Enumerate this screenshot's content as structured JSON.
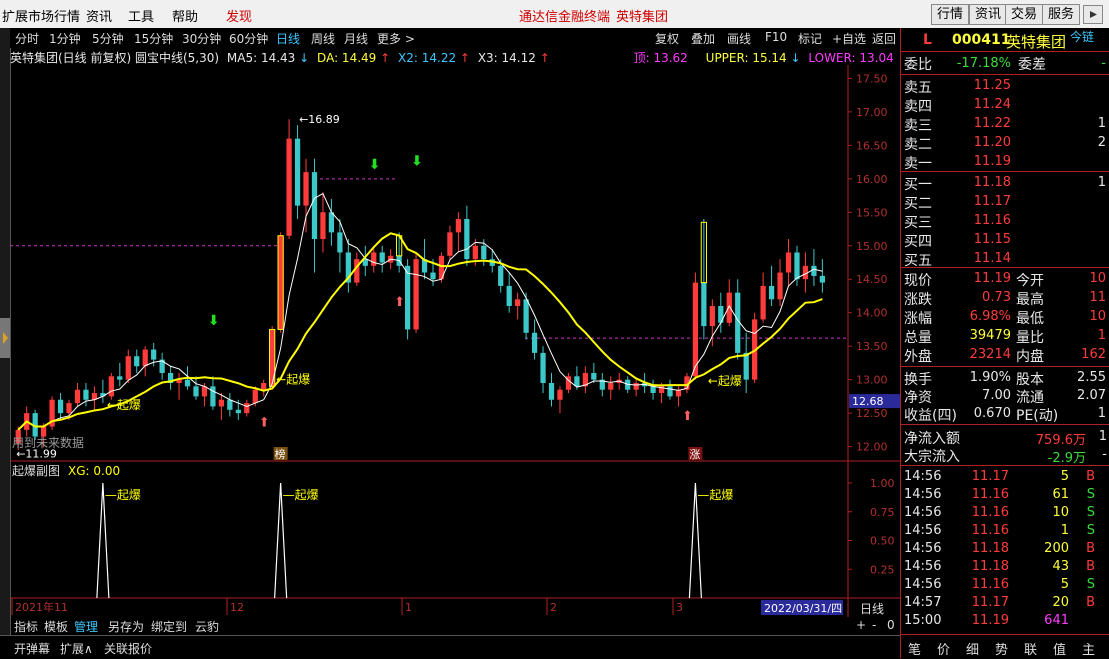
{
  "menu": {
    "items": [
      "扩展市场行情",
      "资讯",
      "工具",
      "帮助"
    ],
    "discover": "发现",
    "center_title": "通达信金融终端",
    "center_stock": "英特集团",
    "right_buttons": [
      "行情",
      "资讯",
      "交易",
      "服务"
    ]
  },
  "periods": {
    "items": [
      "分时",
      "1分钟",
      "5分钟",
      "15分钟",
      "30分钟",
      "60分钟",
      "日线",
      "周线",
      "月线",
      "更多 >"
    ],
    "active_index": 6,
    "right_tools": [
      "复权",
      "叠加",
      "画线",
      "F10",
      "标记",
      "+自选",
      "返回"
    ]
  },
  "title_bar": {
    "name": "英特集团(日线 前复权) 圆宝中线(5,30)",
    "ma5": "MA5: 14.43",
    "da": "DA: 14.49",
    "x2": "X2: 14.22",
    "x3": "X3: 14.12",
    "ding": "顶: 13.62",
    "upper": "UPPER: 15.14",
    "lower": "LOWER: 13.04"
  },
  "colors": {
    "up": "#ff3c3c",
    "down": "#3cc8c8",
    "ma": "#ffffff",
    "mid": "#ffff00",
    "dash": "#cc33cc",
    "accent": "#3cc8ff"
  },
  "chart_data": {
    "type": "candlestick",
    "ylim": [
      11.8,
      17.7
    ],
    "yticks": [
      "17.50",
      "17.00",
      "16.50",
      "16.00",
      "15.50",
      "15.00",
      "14.50",
      "14.00",
      "13.50",
      "13.00",
      "12.50",
      "12.00"
    ],
    "price_tag": "12.68",
    "max_label": "16.89",
    "min_label": "11.99",
    "qibao_labels": [
      "起爆",
      "起爆",
      "起爆"
    ],
    "future_note": "用到未来数据",
    "badge_bang": "榜",
    "badge_zhang": "涨",
    "candles": [
      [
        12.05,
        12.3,
        11.95,
        12.25
      ],
      [
        12.25,
        12.6,
        12.15,
        12.5
      ],
      [
        12.5,
        12.55,
        12.1,
        12.15
      ],
      [
        12.15,
        12.35,
        11.99,
        12.3
      ],
      [
        12.3,
        12.75,
        12.25,
        12.7
      ],
      [
        12.7,
        12.8,
        12.4,
        12.5
      ],
      [
        12.5,
        12.7,
        12.4,
        12.65
      ],
      [
        12.65,
        12.95,
        12.6,
        12.85
      ],
      [
        12.85,
        12.95,
        12.6,
        12.7
      ],
      [
        12.7,
        12.9,
        12.55,
        12.8
      ],
      [
        12.8,
        13.0,
        12.65,
        12.75
      ],
      [
        12.75,
        13.1,
        12.7,
        13.05
      ],
      [
        13.05,
        13.25,
        12.9,
        13.0
      ],
      [
        13.0,
        13.45,
        12.95,
        13.35
      ],
      [
        13.35,
        13.45,
        13.1,
        13.2
      ],
      [
        13.2,
        13.5,
        13.05,
        13.45
      ],
      [
        13.45,
        13.55,
        13.2,
        13.3
      ],
      [
        13.3,
        13.4,
        13.0,
        13.1
      ],
      [
        13.1,
        13.2,
        12.85,
        12.95
      ],
      [
        12.95,
        13.1,
        12.7,
        13.0
      ],
      [
        13.0,
        13.2,
        12.85,
        12.9
      ],
      [
        12.9,
        13.05,
        12.7,
        12.75
      ],
      [
        12.75,
        12.95,
        12.6,
        12.9
      ],
      [
        12.9,
        13.05,
        12.55,
        12.6
      ],
      [
        12.6,
        12.8,
        12.4,
        12.7
      ],
      [
        12.7,
        12.8,
        12.45,
        12.55
      ],
      [
        12.55,
        12.7,
        12.4,
        12.5
      ],
      [
        12.5,
        12.7,
        12.45,
        12.65
      ],
      [
        12.65,
        12.9,
        12.6,
        12.85
      ],
      [
        12.85,
        13.0,
        12.75,
        12.95
      ],
      [
        12.9,
        13.8,
        12.85,
        13.75
      ],
      [
        13.75,
        15.2,
        13.7,
        15.15
      ],
      [
        15.15,
        16.89,
        15.1,
        16.6
      ],
      [
        16.6,
        16.8,
        15.4,
        15.6
      ],
      [
        15.6,
        16.3,
        15.2,
        16.1
      ],
      [
        16.1,
        16.3,
        14.6,
        15.1
      ],
      [
        15.1,
        15.8,
        14.9,
        15.5
      ],
      [
        15.5,
        15.7,
        15.0,
        15.2
      ],
      [
        15.2,
        15.4,
        14.6,
        14.9
      ],
      [
        14.9,
        15.1,
        14.3,
        14.45
      ],
      [
        14.45,
        14.9,
        14.4,
        14.8
      ],
      [
        14.8,
        15.0,
        14.55,
        14.7
      ],
      [
        14.7,
        14.95,
        14.6,
        14.9
      ],
      [
        14.9,
        15.0,
        14.6,
        14.75
      ],
      [
        14.75,
        14.95,
        14.65,
        14.85
      ],
      [
        14.85,
        15.2,
        14.6,
        14.7
      ],
      [
        14.7,
        14.8,
        13.6,
        13.75
      ],
      [
        13.75,
        14.9,
        13.7,
        14.8
      ],
      [
        14.8,
        15.1,
        14.5,
        14.6
      ],
      [
        14.6,
        14.8,
        14.4,
        14.5
      ],
      [
        14.5,
        14.9,
        14.45,
        14.85
      ],
      [
        14.85,
        15.3,
        14.8,
        15.2
      ],
      [
        15.2,
        15.5,
        14.9,
        15.4
      ],
      [
        15.4,
        15.6,
        14.7,
        14.8
      ],
      [
        14.8,
        15.1,
        14.7,
        15.0
      ],
      [
        15.0,
        15.1,
        14.7,
        14.8
      ],
      [
        14.8,
        14.95,
        14.6,
        14.7
      ],
      [
        14.7,
        14.8,
        14.3,
        14.4
      ],
      [
        14.4,
        14.6,
        14.0,
        14.1
      ],
      [
        14.1,
        14.3,
        13.9,
        14.2
      ],
      [
        14.2,
        14.3,
        13.6,
        13.7
      ],
      [
        13.7,
        13.9,
        13.3,
        13.4
      ],
      [
        13.4,
        13.5,
        12.8,
        12.95
      ],
      [
        12.95,
        13.1,
        12.6,
        12.7
      ],
      [
        12.7,
        12.9,
        12.5,
        12.85
      ],
      [
        12.85,
        13.1,
        12.8,
        13.05
      ],
      [
        13.05,
        13.2,
        12.85,
        12.9
      ],
      [
        12.9,
        13.2,
        12.8,
        13.1
      ],
      [
        13.1,
        13.25,
        12.95,
        13.0
      ],
      [
        13.0,
        13.1,
        12.75,
        12.85
      ],
      [
        12.85,
        13.05,
        12.7,
        12.95
      ],
      [
        12.95,
        13.1,
        12.85,
        13.0
      ],
      [
        13.0,
        13.05,
        12.8,
        12.85
      ],
      [
        12.85,
        13.0,
        12.75,
        12.95
      ],
      [
        12.95,
        13.1,
        12.8,
        12.9
      ],
      [
        12.9,
        13.0,
        12.7,
        12.8
      ],
      [
        12.8,
        12.95,
        12.65,
        12.9
      ],
      [
        12.9,
        13.0,
        12.7,
        12.75
      ],
      [
        12.75,
        12.9,
        12.6,
        12.85
      ],
      [
        12.85,
        13.1,
        12.8,
        13.05
      ],
      [
        13.05,
        14.6,
        13.0,
        14.45
      ],
      [
        14.45,
        15.4,
        13.6,
        13.8
      ],
      [
        13.8,
        14.2,
        13.5,
        14.1
      ],
      [
        14.1,
        14.3,
        13.7,
        13.85
      ],
      [
        13.85,
        14.5,
        13.8,
        14.3
      ],
      [
        14.3,
        14.5,
        13.3,
        13.4
      ],
      [
        13.4,
        13.7,
        12.8,
        13.0
      ],
      [
        13.0,
        14.0,
        12.95,
        13.9
      ],
      [
        13.9,
        14.6,
        13.85,
        14.4
      ],
      [
        14.4,
        14.7,
        14.1,
        14.2
      ],
      [
        14.2,
        14.8,
        14.1,
        14.6
      ],
      [
        14.6,
        15.1,
        14.4,
        14.9
      ],
      [
        14.9,
        15.0,
        14.4,
        14.5
      ],
      [
        14.5,
        14.9,
        14.3,
        14.7
      ],
      [
        14.7,
        14.95,
        14.4,
        14.55
      ],
      [
        14.55,
        14.8,
        14.3,
        14.45
      ]
    ],
    "volume_panel": {
      "title": "起爆副图",
      "xg": "XG: 0.00",
      "yticks": [
        "1.00",
        "0.75",
        "0.50",
        "0.25"
      ],
      "labels": [
        "起爆",
        "起爆",
        "起爆"
      ]
    },
    "x_axis": {
      "labels": [
        "2021年11",
        "12",
        "1",
        "2",
        "3"
      ],
      "date_box": "2022/03/31/四",
      "period": "日线"
    }
  },
  "quote": {
    "flag": "L",
    "code": "000411",
    "name": "英特集团",
    "link": "今链",
    "weibi_label": "委比",
    "weibi": "-17.18%",
    "weicha_label": "委差",
    "weicha": "-",
    "asks": [
      {
        "label": "卖五",
        "price": "11.25",
        "vol": ""
      },
      {
        "label": "卖四",
        "price": "11.24",
        "vol": ""
      },
      {
        "label": "卖三",
        "price": "11.22",
        "vol": "1"
      },
      {
        "label": "卖二",
        "price": "11.20",
        "vol": "2"
      },
      {
        "label": "卖一",
        "price": "11.19",
        "vol": ""
      }
    ],
    "bids": [
      {
        "label": "买一",
        "price": "11.18",
        "vol": "1"
      },
      {
        "label": "买二",
        "price": "11.17",
        "vol": ""
      },
      {
        "label": "买三",
        "price": "11.16",
        "vol": ""
      },
      {
        "label": "买四",
        "price": "11.15",
        "vol": ""
      },
      {
        "label": "买五",
        "price": "11.14",
        "vol": ""
      }
    ],
    "stats": [
      {
        "l1": "现价",
        "v1": "11.19",
        "c1": "r",
        "l2": "今开",
        "v2": "10"
      },
      {
        "l1": "涨跌",
        "v1": "0.73",
        "c1": "r",
        "l2": "最高",
        "v2": "11"
      },
      {
        "l1": "涨幅",
        "v1": "6.98%",
        "c1": "r",
        "l2": "最低",
        "v2": "10"
      },
      {
        "l1": "总量",
        "v1": "39479",
        "c1": "y",
        "l2": "量比",
        "v2": "1"
      },
      {
        "l1": "外盘",
        "v1": "23214",
        "c1": "r",
        "l2": "内盘",
        "v2": "162"
      }
    ],
    "stats2": [
      {
        "l1": "换手",
        "v1": "1.90%",
        "l2": "股本",
        "v2": "2.55"
      },
      {
        "l1": "净资",
        "v1": "7.00",
        "l2": "流通",
        "v2": "2.07"
      },
      {
        "l1": "收益(四)",
        "v1": "0.670",
        "l2": "PE(动)",
        "v2": "1"
      }
    ],
    "flows": [
      {
        "label": "净流入额",
        "value": "759.6万",
        "extra": "1"
      },
      {
        "label": "大宗流入",
        "value": "-2.9万",
        "extra": "-"
      }
    ],
    "ticks": [
      {
        "t": "14:56",
        "p": "11.17",
        "v": "5",
        "s": "B"
      },
      {
        "t": "14:56",
        "p": "11.16",
        "v": "61",
        "s": "S"
      },
      {
        "t": "14:56",
        "p": "11.16",
        "v": "10",
        "s": "S"
      },
      {
        "t": "14:56",
        "p": "11.16",
        "v": "1",
        "s": "S"
      },
      {
        "t": "14:56",
        "p": "11.18",
        "v": "200",
        "s": "B"
      },
      {
        "t": "14:56",
        "p": "11.18",
        "v": "43",
        "s": "B"
      },
      {
        "t": "14:56",
        "p": "11.16",
        "v": "5",
        "s": "S"
      },
      {
        "t": "14:57",
        "p": "11.17",
        "v": "20",
        "s": "B"
      },
      {
        "t": "15:00",
        "p": "11.19",
        "v": "641",
        "s": ""
      }
    ],
    "bottom_tabs": [
      "笔",
      "价",
      "细",
      "势",
      "联",
      "值",
      "主"
    ]
  },
  "bottom_tabs": {
    "items": [
      "指标",
      "模板",
      "管理",
      "另存为",
      "绑定到",
      "云豹"
    ],
    "active_index": 2,
    "scroll": [
      "+",
      "-",
      "0"
    ]
  },
  "status": [
    "开弹幕",
    "扩展∧",
    "关联报价"
  ]
}
